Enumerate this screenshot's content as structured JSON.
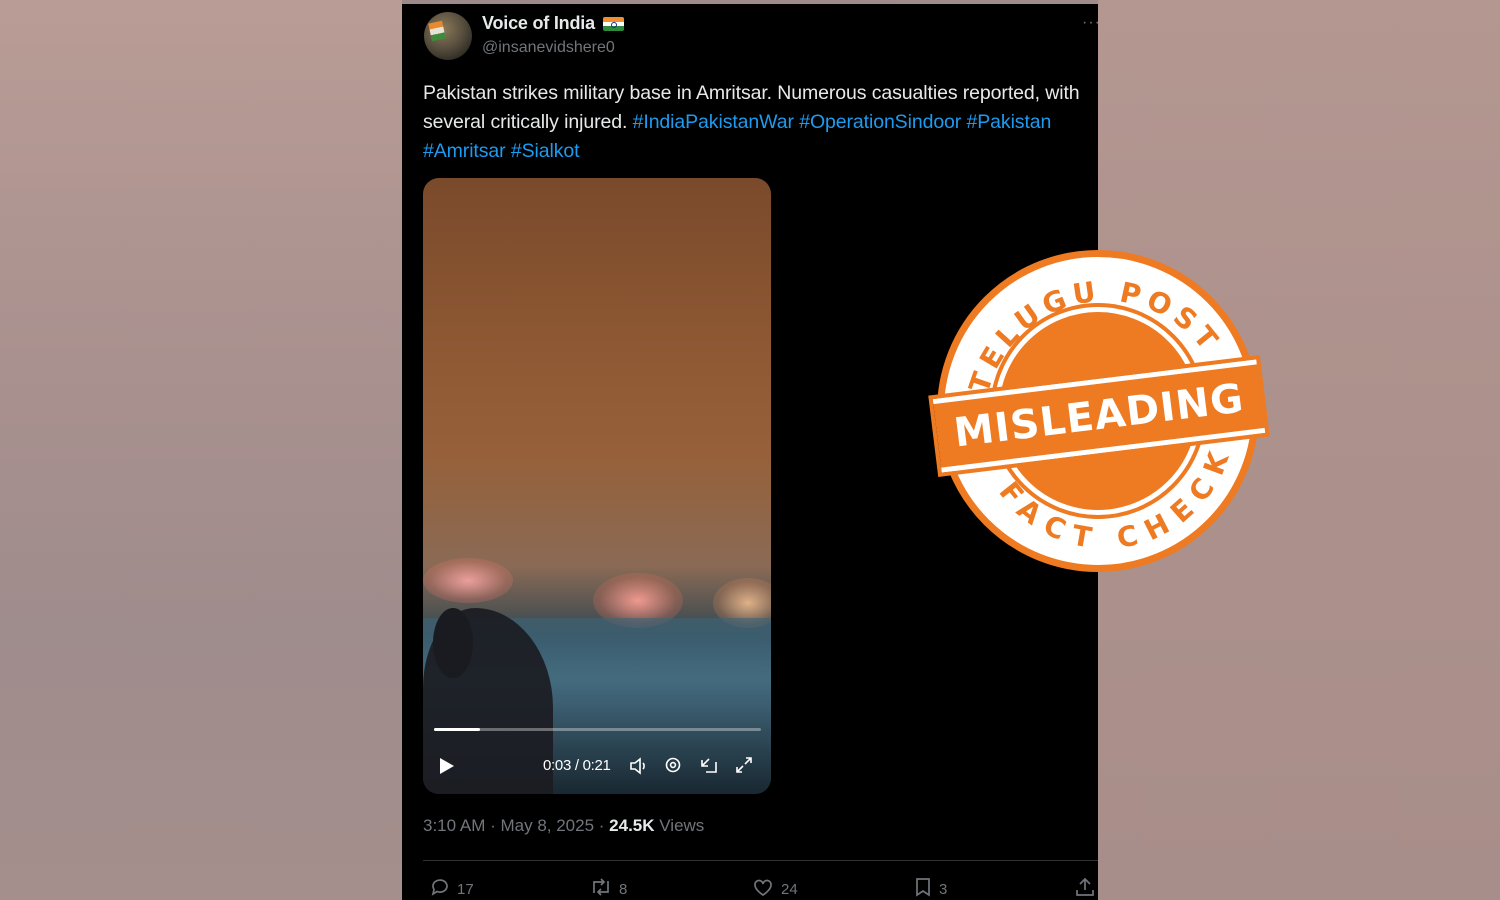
{
  "tweet": {
    "display_name": "Voice of India",
    "handle": "@insanevidshere0",
    "more_label": "···",
    "text_plain": "Pakistan strikes military base in Amritsar. Numerous casualties reported, with several critically injured.",
    "hashtags": [
      "#IndiaPakistanWar",
      "#OperationSindoor",
      "#Pakistan",
      "#Amritsar",
      "#Sialkot"
    ],
    "timestamp": "3:10 AM · May 8, 2025 · ",
    "views_count": "24.5K",
    "views_label": " Views"
  },
  "video": {
    "time": "0:03 / 0:21",
    "progress": 0.14,
    "icons": [
      "play-icon",
      "volume-icon",
      "settings-icon",
      "collapse-icon",
      "fullscreen-icon"
    ]
  },
  "actions": {
    "reply_count": "17",
    "retweet_count": "8",
    "like_count": "24",
    "bookmark_count": "3"
  },
  "stamp": {
    "top_text": "TELUGU POST",
    "center_text": "MISLEADING",
    "bottom_text": "FACT CHECK",
    "color": "#ee7a22"
  },
  "colors": {
    "background": "#000000",
    "text": "#e7e9ea",
    "secondary": "#71767b",
    "link": "#1d9bf0"
  }
}
